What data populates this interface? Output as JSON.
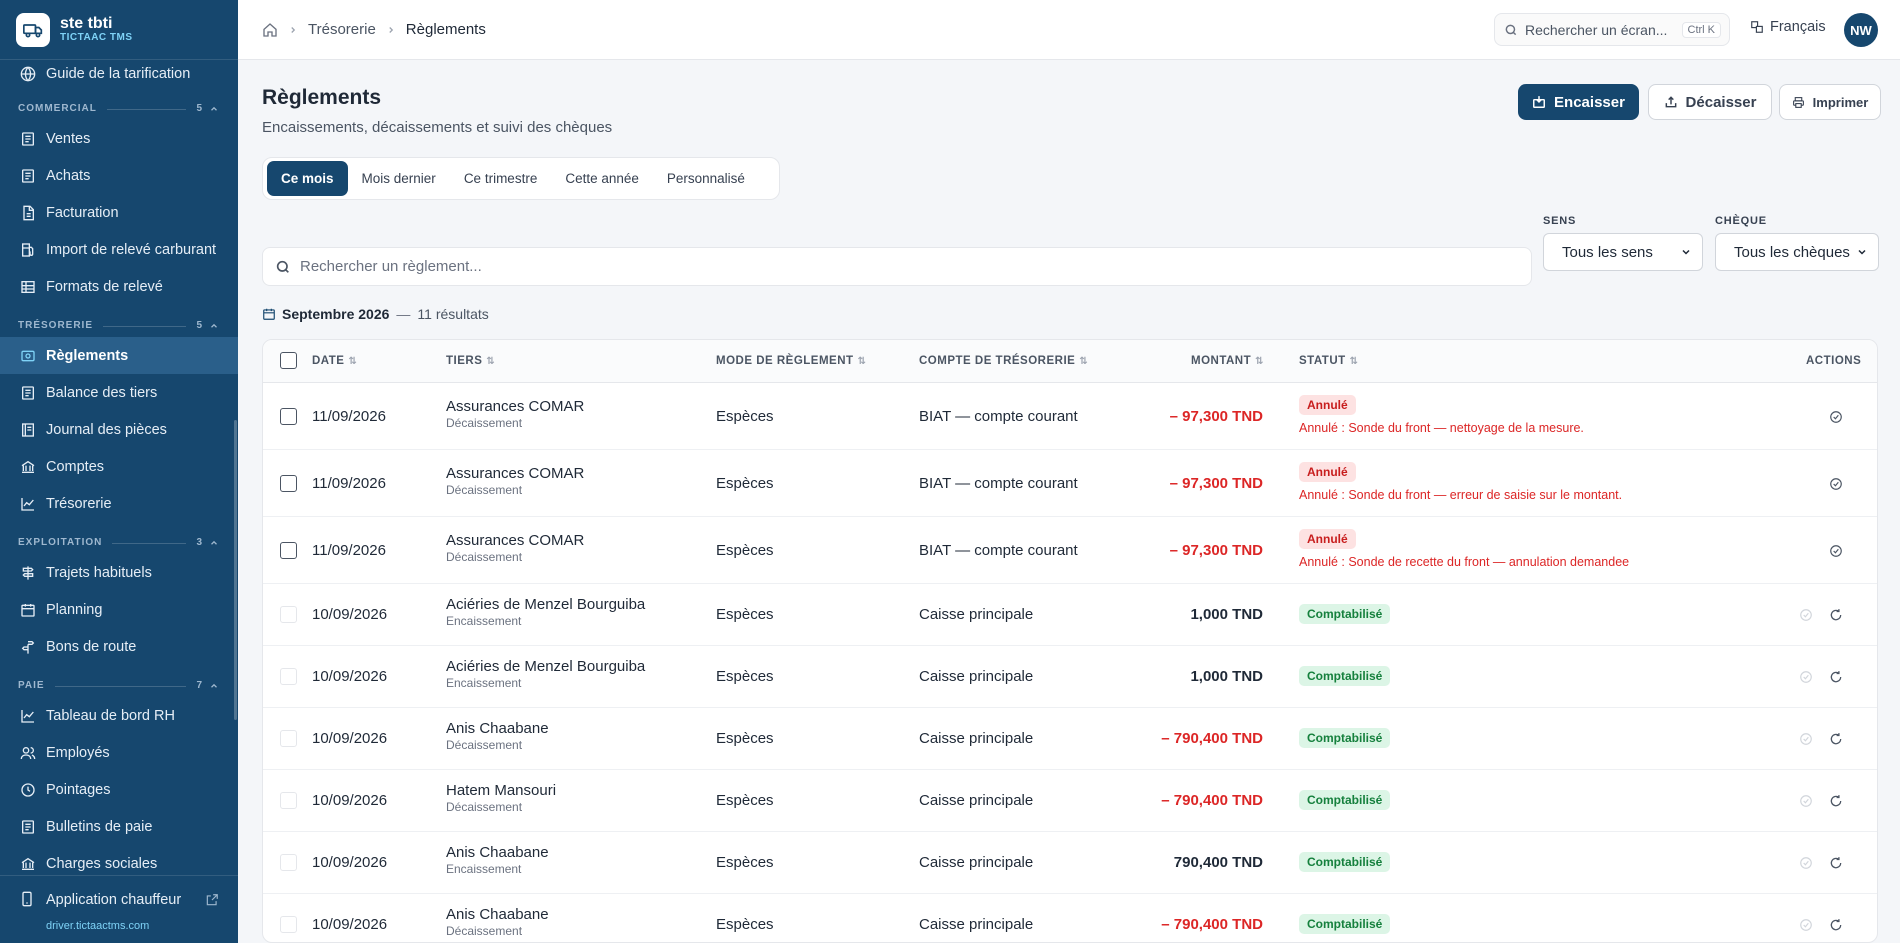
{
  "brand": {
    "name": "ste tbti",
    "sub": "TICTAAC TMS"
  },
  "sidebar": {
    "top_item": "Guide de la tarification",
    "sections": [
      {
        "title": "COMMERCIAL",
        "count": "5",
        "items": [
          "Ventes",
          "Achats",
          "Facturation",
          "Import de relevé carburant",
          "Formats de relevé"
        ]
      },
      {
        "title": "TRÉSORERIE",
        "count": "5",
        "items": [
          "Règlements",
          "Balance des tiers",
          "Journal des pièces",
          "Comptes",
          "Trésorerie"
        ]
      },
      {
        "title": "EXPLOITATION",
        "count": "3",
        "items": [
          "Trajets habituels",
          "Planning",
          "Bons de route"
        ]
      },
      {
        "title": "PAIE",
        "count": "7",
        "items": [
          "Tableau de bord RH",
          "Employés",
          "Pointages",
          "Bulletins de paie",
          "Charges sociales"
        ]
      }
    ],
    "active": "Règlements",
    "footer_link": "Application chauffeur",
    "footer_url": "driver.tictaactms.com"
  },
  "header": {
    "crumbs": [
      "Trésorerie",
      "Règlements"
    ],
    "search_placeholder": "Rechercher un écran...",
    "shortcut": "Ctrl K",
    "language": "Français",
    "avatar": "NW"
  },
  "page": {
    "title": "Règlements",
    "subtitle": "Encaissements, décaissements et suivi des chèques",
    "actions": {
      "encaisser": "Encaisser",
      "decaisser": "Décaisser",
      "imprimer": "Imprimer"
    },
    "periods": [
      "Ce mois",
      "Mois dernier",
      "Ce trimestre",
      "Cette année",
      "Personnalisé"
    ],
    "active_period": "Ce mois",
    "filters": {
      "sens_label": "SENS",
      "sens_value": "Tous les sens",
      "cheque_label": "CHÈQUE",
      "cheque_value": "Tous les chèques"
    },
    "search_placeholder": "Rechercher un règlement...",
    "results_period": "Septembre 2026",
    "results_sep": "—",
    "results_count": "11 résultats"
  },
  "table": {
    "columns": {
      "date": "DATE",
      "tiers": "TIERS",
      "mode": "MODE DE RÈGLEMENT",
      "compte": "COMPTE DE TRÉSORERIE",
      "montant": "MONTANT",
      "statut": "STATUT",
      "actions": "ACTIONS"
    },
    "rows": [
      {
        "date": "11/09/2026",
        "tiers": "Assurances COMAR",
        "type": "Décaissement",
        "mode": "Espèces",
        "compte": "BIAT — compte courant",
        "montant": "– 97,300 TND",
        "negative": true,
        "statut": "Annulé",
        "note": "Annulé : Sonde du front — nettoyage de la mesure."
      },
      {
        "date": "11/09/2026",
        "tiers": "Assurances COMAR",
        "type": "Décaissement",
        "mode": "Espèces",
        "compte": "BIAT — compte courant",
        "montant": "– 97,300 TND",
        "negative": true,
        "statut": "Annulé",
        "note": "Annulé : Sonde du front — erreur de saisie sur le montant."
      },
      {
        "date": "11/09/2026",
        "tiers": "Assurances COMAR",
        "type": "Décaissement",
        "mode": "Espèces",
        "compte": "BIAT — compte courant",
        "montant": "– 97,300 TND",
        "negative": true,
        "statut": "Annulé",
        "note": "Annulé : Sonde de recette du front — annulation demandee"
      },
      {
        "date": "10/09/2026",
        "tiers": "Aciéries de Menzel Bourguiba",
        "type": "Encaissement",
        "mode": "Espèces",
        "compte": "Caisse principale",
        "montant": "1,000 TND",
        "negative": false,
        "statut": "Comptabilisé",
        "note": ""
      },
      {
        "date": "10/09/2026",
        "tiers": "Aciéries de Menzel Bourguiba",
        "type": "Encaissement",
        "mode": "Espèces",
        "compte": "Caisse principale",
        "montant": "1,000 TND",
        "negative": false,
        "statut": "Comptabilisé",
        "note": ""
      },
      {
        "date": "10/09/2026",
        "tiers": "Anis Chaabane",
        "type": "Décaissement",
        "mode": "Espèces",
        "compte": "Caisse principale",
        "montant": "– 790,400 TND",
        "negative": true,
        "statut": "Comptabilisé",
        "note": ""
      },
      {
        "date": "10/09/2026",
        "tiers": "Hatem Mansouri",
        "type": "Décaissement",
        "mode": "Espèces",
        "compte": "Caisse principale",
        "montant": "– 790,400 TND",
        "negative": true,
        "statut": "Comptabilisé",
        "note": ""
      },
      {
        "date": "10/09/2026",
        "tiers": "Anis Chaabane",
        "type": "Encaissement",
        "mode": "Espèces",
        "compte": "Caisse principale",
        "montant": "790,400 TND",
        "negative": false,
        "statut": "Comptabilisé",
        "note": ""
      },
      {
        "date": "10/09/2026",
        "tiers": "Anis Chaabane",
        "type": "Décaissement",
        "mode": "Espèces",
        "compte": "Caisse principale",
        "montant": "– 790,400 TND",
        "negative": true,
        "statut": "Comptabilisé",
        "note": ""
      }
    ]
  }
}
